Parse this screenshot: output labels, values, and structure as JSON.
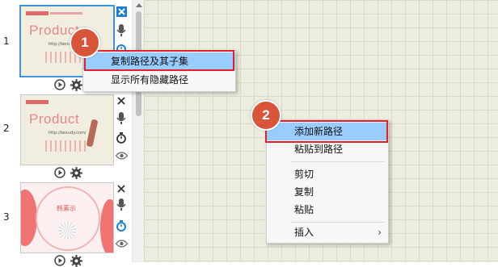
{
  "slides": [
    {
      "number": "1",
      "brand": "Product",
      "url": "http://kenodo.com/"
    },
    {
      "number": "2",
      "brand": "Product",
      "url": "http://kexudy.com/"
    },
    {
      "number": "3",
      "title": "韩素示"
    }
  ],
  "menu1": {
    "items": [
      {
        "label": "复制路径及其子集"
      },
      {
        "label": "显示所有隐藏路径"
      }
    ]
  },
  "menu2": {
    "items": [
      {
        "label": "添加新路径"
      },
      {
        "label": "粘贴到路径"
      },
      {
        "label": "剪切"
      },
      {
        "label": "复制"
      },
      {
        "label": "粘贴"
      },
      {
        "label": "插入",
        "submenu_arrow": "›"
      }
    ]
  },
  "badges": {
    "first": "1",
    "second": "2"
  },
  "colors": {
    "highlight": "#99ccff",
    "outline": "#e3202a",
    "badge": "#d8553a",
    "selection": "#3a96dd"
  }
}
